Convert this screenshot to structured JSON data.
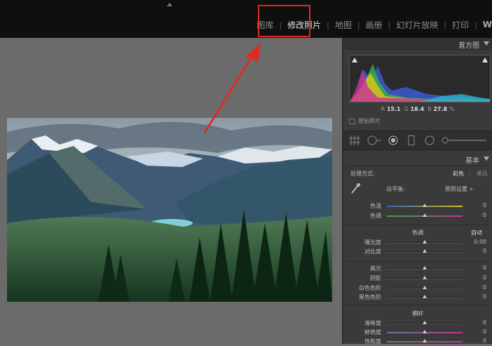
{
  "modules": [
    {
      "label": "图库",
      "active": false
    },
    {
      "label": "修改照片",
      "active": true
    },
    {
      "label": "地图",
      "active": false
    },
    {
      "label": "画册",
      "active": false
    },
    {
      "label": "幻灯片放映",
      "active": false
    },
    {
      "label": "打印",
      "active": false
    },
    {
      "label": "W",
      "active": false
    }
  ],
  "panel": {
    "histogram_title": "直方图",
    "rgb": {
      "r_label": "R",
      "r": "15.1",
      "g_label": "G",
      "g": "18.4",
      "b_label": "B",
      "b": "27.8",
      "unit": "%"
    },
    "original_photo": "原始照片",
    "basic_title": "基本",
    "process_label": "处理方式:",
    "process_color": "彩色",
    "process_bw": "黑白",
    "wb_label": "白平衡:",
    "wb_value": "原照设置 ÷",
    "temp_label": "色温",
    "temp_value": "0",
    "tint_label": "色调",
    "tint_value": "0",
    "tone_title": "色调",
    "auto": "自动",
    "exposure_label": "曝光度",
    "exposure_value": "0.00",
    "contrast_label": "对比度",
    "contrast_value": "0",
    "highlights_label": "高光",
    "highlights_value": "0",
    "shadows_label": "阴影",
    "shadows_value": "0",
    "whites_label": "白色色阶",
    "whites_value": "0",
    "blacks_label": "黑色色阶",
    "blacks_value": "0",
    "presence_title": "偏好",
    "clarity_label": "清晰度",
    "clarity_value": "0",
    "vibrance_label": "鲜艳度",
    "vibrance_value": "0",
    "saturation_label": "饱和度",
    "saturation_value": "0"
  },
  "colors": {
    "highlight": "#e02b25",
    "accent": "#e6e6e6"
  }
}
